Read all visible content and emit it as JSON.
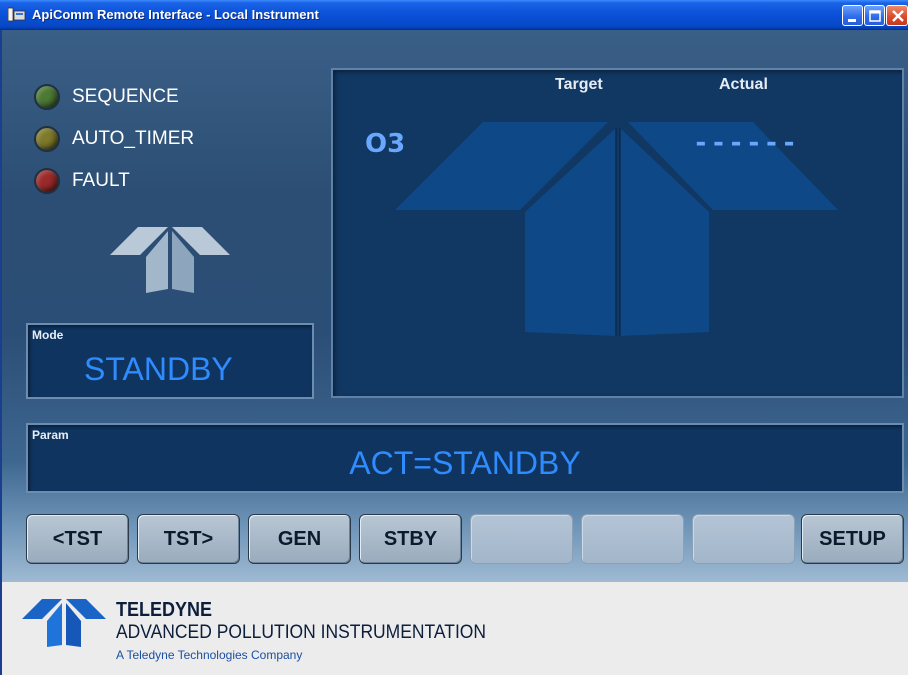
{
  "window": {
    "title": "ApiComm Remote Interface - Local Instrument",
    "icons": [
      "app-icon",
      "minimize-icon",
      "maximize-icon",
      "close-icon"
    ]
  },
  "status_leds": [
    {
      "label": "SEQUENCE",
      "color": "#4c7a34"
    },
    {
      "label": "AUTO_TIMER",
      "color": "#7f7a2a"
    },
    {
      "label": "FAULT",
      "color": "#9b2a2a"
    }
  ],
  "mode": {
    "label": "Mode",
    "value": "STANDBY"
  },
  "gas_display": {
    "target_header": "Target",
    "actual_header": "Actual",
    "gas": "O3",
    "actual_value": "------"
  },
  "param": {
    "label": "Param",
    "value": "ACT=STANDBY"
  },
  "function_keys": [
    "<TST",
    "TST>",
    "GEN",
    "STBY",
    "",
    "",
    "",
    "SETUP"
  ],
  "footer": {
    "brand": "TELEDYNE",
    "subtitle": "ADVANCED POLLUTION INSTRUMENTATION",
    "tagline": "A Teledyne Technologies Company"
  },
  "colors": {
    "accent_text": "#2f8cff",
    "panel_bg": "#0f3460",
    "titlebar": "#0a50d8"
  }
}
